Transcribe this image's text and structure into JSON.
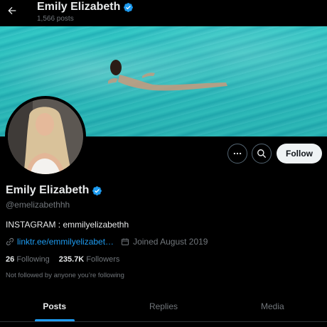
{
  "header": {
    "name": "Emily Elizabeth",
    "post_count": "1,566 posts",
    "back_icon": "arrow-left-icon"
  },
  "profile": {
    "name": "Emily Elizabeth",
    "handle": "@emelizabethhh",
    "bio": "INSTAGRAM : emmilyelizabethh",
    "link": "linktr.ee/emmilyelizabet…",
    "joined": "Joined August 2019",
    "following_count": "26",
    "following_label": "Following",
    "followers_count": "235.7K",
    "followers_label": "Followers",
    "follow_note": "Not followed by anyone you’re following"
  },
  "actions": {
    "follow_label": "Follow",
    "more_icon": "more-icon",
    "search_icon": "search-icon"
  },
  "tabs": [
    {
      "label": "Posts",
      "active": true
    },
    {
      "label": "Replies",
      "active": false
    },
    {
      "label": "Media",
      "active": false
    }
  ],
  "colors": {
    "accent": "#1d9bf0",
    "background": "#000000",
    "text": "#e7e9ea",
    "muted": "#71767b",
    "verified": "#1d9bf0"
  }
}
